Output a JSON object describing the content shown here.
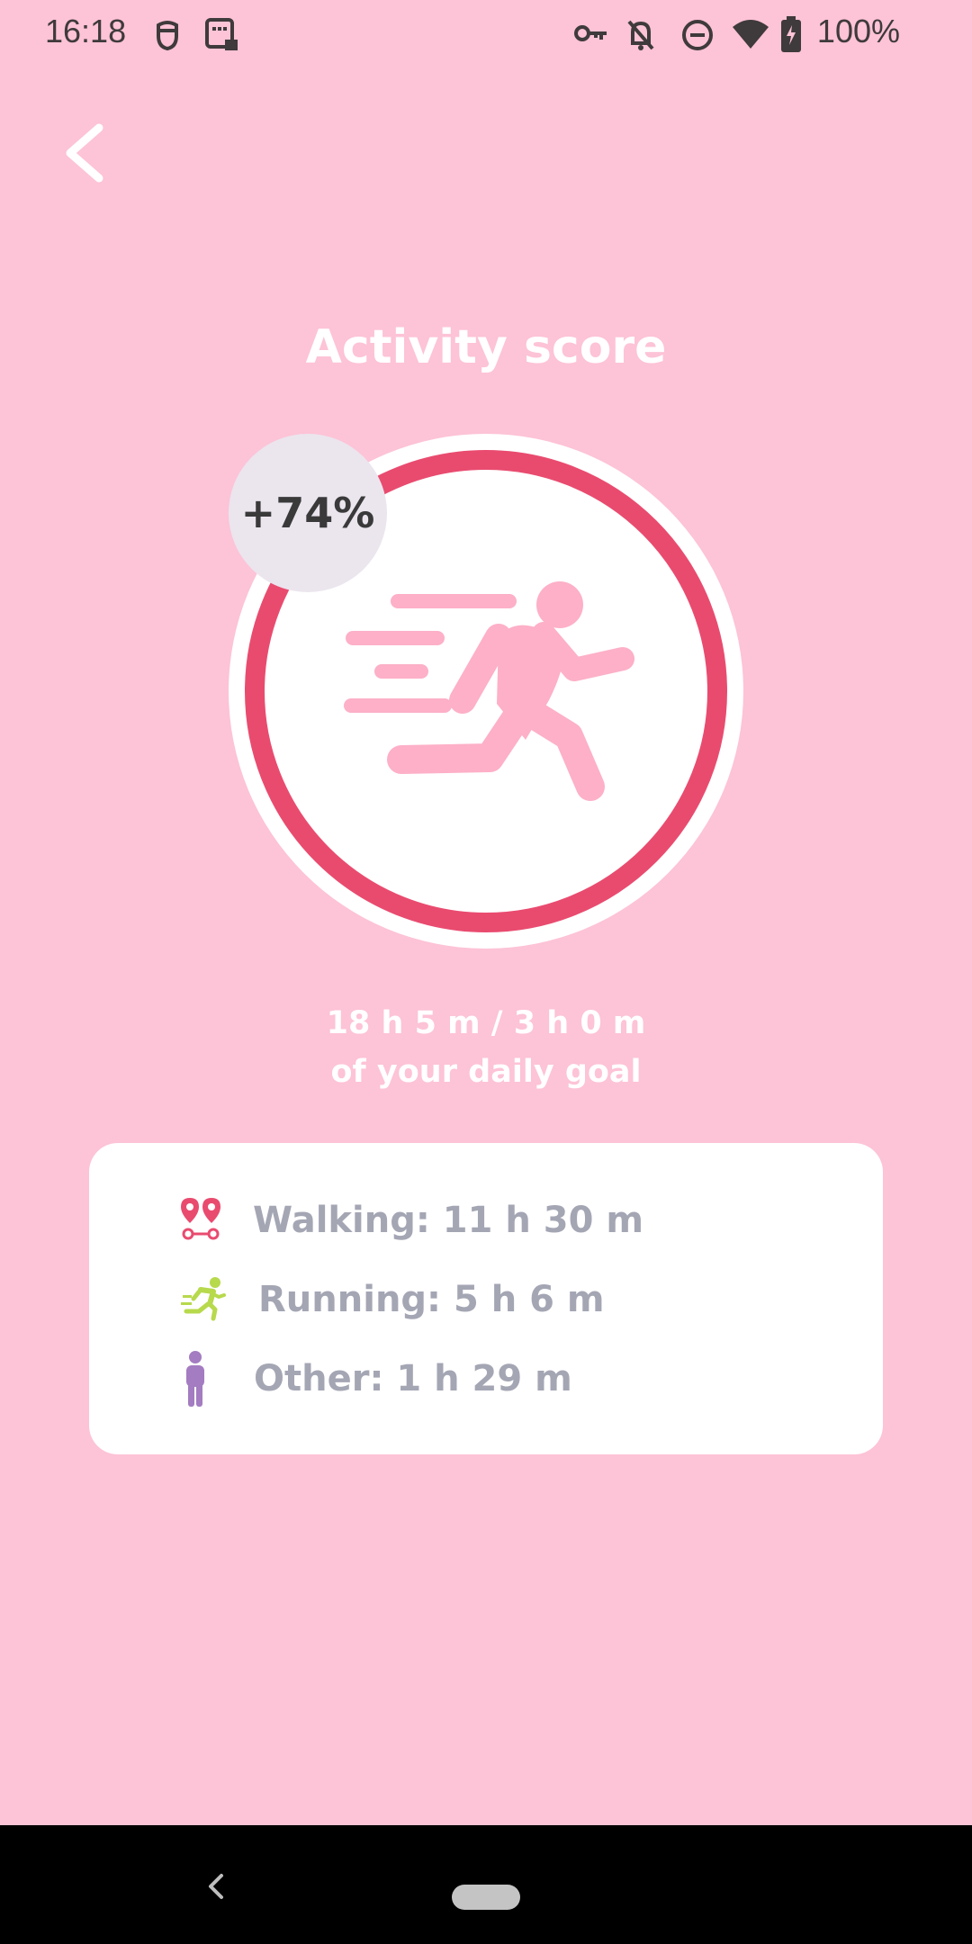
{
  "status_bar": {
    "time": "16:18",
    "battery_percent": "100%",
    "icons": [
      "face-icon",
      "screenshot-lock-icon",
      "vpn-key-icon",
      "notifications-off-icon",
      "do-not-disturb-icon",
      "wifi-icon",
      "battery-charging-icon"
    ]
  },
  "header": {
    "back_icon": "chevron-left-icon",
    "title": "Activity score"
  },
  "score": {
    "percent_label": "+74%",
    "progress_fraction": 1.0,
    "ring_color": "#e94b6f",
    "figure_color": "#fdb0c8",
    "icon": "running-person-icon"
  },
  "goal": {
    "line1": "18 h 5 m / 3 h 0 m",
    "line2": "of your daily goal"
  },
  "breakdown": {
    "items": [
      {
        "icon": "walking-route-icon",
        "label": "Walking: 11 h 30 m",
        "icon_color": "#e94b6f"
      },
      {
        "icon": "running-icon",
        "label": "Running: 5 h 6 m",
        "icon_color": "#b7d94c"
      },
      {
        "icon": "standing-person-icon",
        "label": "Other: 1 h 29 m",
        "icon_color": "#a47cc1"
      }
    ]
  },
  "nav_bar": {
    "back_icon": "nav-back-icon",
    "home_icon": "nav-home-pill-icon"
  }
}
